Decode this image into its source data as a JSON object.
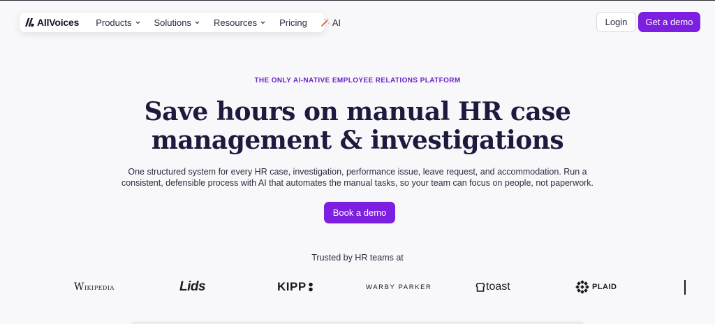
{
  "nav": {
    "brand": "AllVoices",
    "items": [
      {
        "label": "Products",
        "has_dropdown": true
      },
      {
        "label": "Solutions",
        "has_dropdown": true
      },
      {
        "label": "Resources",
        "has_dropdown": true
      },
      {
        "label": "Pricing",
        "has_dropdown": false
      },
      {
        "label": "AI",
        "icon": "magic-wand-icon"
      }
    ],
    "login_label": "Login",
    "demo_label": "Get a demo"
  },
  "hero": {
    "eyebrow": "THE ONLY AI-NATIVE EMPLOYEE RELATIONS PLATFORM",
    "headline_line1": "Save hours on manual HR case",
    "headline_line2": "management & investigations",
    "sub_line1": "One structured system for every HR case, investigation, performance issue, leave request, and accommodation. Run a",
    "sub_line2": "consistent, defensible process with AI that automates the manual tasks, so your team can focus on people, not paperwork.",
    "cta_label": "Book a demo"
  },
  "trusted": {
    "label": "Trusted by HR teams at",
    "logos": {
      "wikipedia": "Wikipedia",
      "lids": "Lids",
      "kipp": "KIPP",
      "warby": "WARBY PARKER",
      "toast": "toast",
      "plaid": "PLAID"
    }
  },
  "colors": {
    "accent": "#7d1fe0",
    "eyebrow": "#6a22c7",
    "heading": "#1c1a3d",
    "background": "#f8f8fa"
  }
}
